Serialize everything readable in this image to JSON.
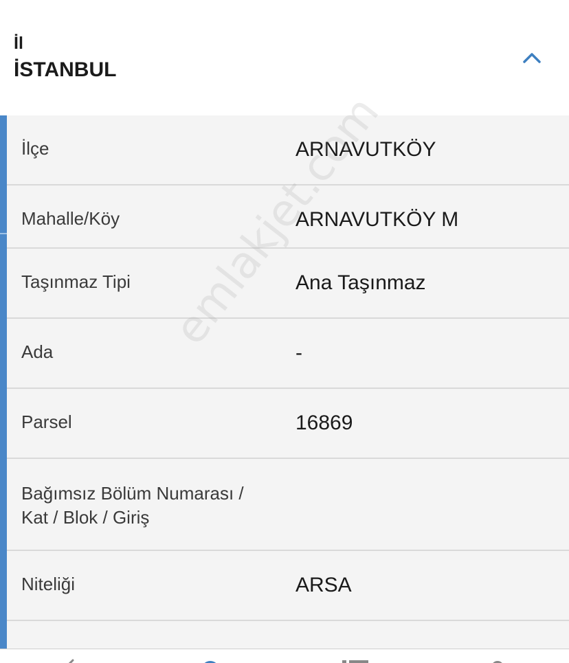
{
  "header": {
    "label": "İl",
    "value": "İSTANBUL"
  },
  "rows": [
    {
      "key": "İlçe",
      "value": "ARNAVUTKÖY"
    },
    {
      "key": "Mahalle/Köy",
      "value": "ARNAVUTKÖY M"
    },
    {
      "key": "Taşınmaz Tipi",
      "value": "Ana Taşınmaz"
    },
    {
      "key": "Ada",
      "value": "-"
    },
    {
      "key": "Parsel",
      "value": "16869"
    },
    {
      "key_line1": "Bağımsız Bölüm Numarası /",
      "key_line2": "Kat / Blok / Giriş",
      "value": ""
    },
    {
      "key": "Niteliği",
      "value": "ARSA"
    }
  ],
  "watermark": "emlakjet.com",
  "colors": {
    "accent": "#4a87c8",
    "row_bg": "#f4f4f4",
    "divider": "#d9d9d9"
  },
  "icons": {
    "collapse": "chevron-up-icon",
    "tabs": [
      "back-icon",
      "info-icon",
      "list-icon",
      "profile-icon"
    ]
  }
}
